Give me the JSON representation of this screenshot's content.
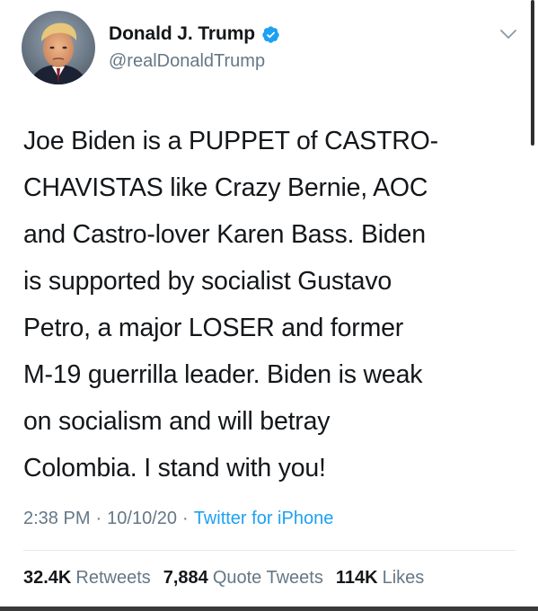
{
  "author": {
    "display_name": "Donald J. Trump",
    "handle": "@realDonaldTrump",
    "verified": true
  },
  "tweet": {
    "lines": [
      "Joe Biden is a PUPPET of CASTRO-",
      "CHAVISTAS like Crazy Bernie, AOC",
      "and Castro-lover Karen Bass. Biden",
      "is supported by socialist Gustavo",
      "Petro, a major LOSER and former",
      "M-19 guerrilla leader. Biden is weak",
      "on socialism and will betray",
      "Colombia. I stand with you!"
    ],
    "time": "2:38 PM",
    "separator": "·",
    "date": "10/10/20",
    "source": "Twitter for iPhone"
  },
  "stats": {
    "retweets_count": "32.4K",
    "retweets_label": "Retweets",
    "quote_tweets_count": "7,884",
    "quote_tweets_label": "Quote Tweets",
    "likes_count": "114K",
    "likes_label": "Likes"
  },
  "icons": {
    "verified": "verified-badge-icon",
    "caret": "chevron-down-icon"
  },
  "colors": {
    "accent": "#1da1f2",
    "secondary_text": "#657786",
    "primary_text": "#14171a",
    "divider": "#e1e8ed"
  }
}
